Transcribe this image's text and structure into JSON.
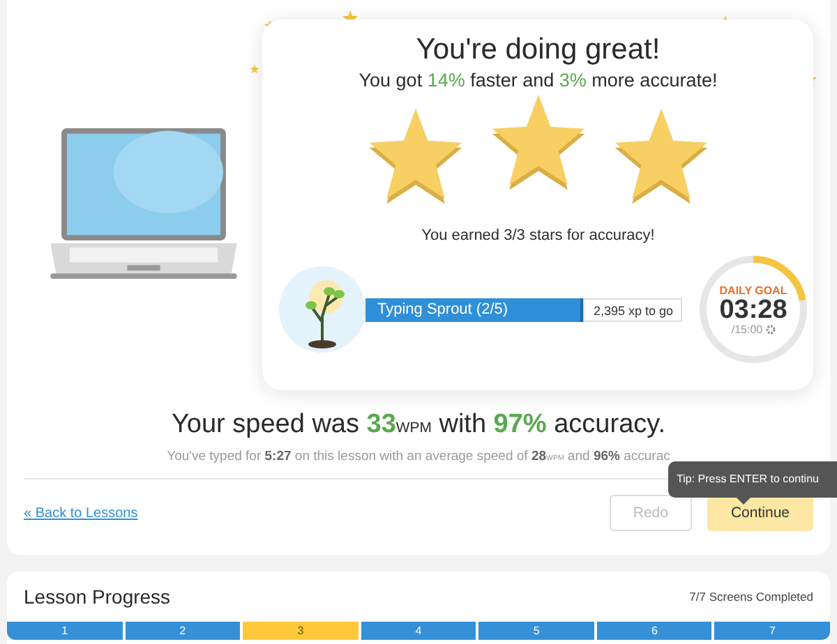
{
  "celebration": {
    "title": "You're doing great!",
    "subtitle": "You got **14%** faster and **3%** more accurate!",
    "stars": 3,
    "stars_caption": "You earned 3/3 stars for accuracy!"
  },
  "rank": {
    "name": "Typing Sprout (2/5)",
    "xp": "2,395 xp to go"
  },
  "daily_goal": {
    "label": "DAILY GOAL",
    "time": "03:28",
    "target": "/15:00",
    "level": 0.22
  },
  "speed": {
    "headline": "Your speed was **33**$_{WPM}$ with **97%** accuracy.",
    "detail": "You've typed for **5:27** on this lesson with an average speed of **28**$_{WPM}$ and **96%** accurac"
  },
  "back_link": "« Back to Lessons",
  "buttons": [
    {
      "label": "Redo",
      "disabled": true
    },
    {
      "label": "Continue",
      "disabled": false
    }
  ],
  "tooltip": "Tip: Press ENTER to continu",
  "lesson_progress": {
    "title": "Lesson Progress",
    "summary": "7/7 Screens Completed",
    "segments": [
      {
        "label": "1",
        "selected": false
      },
      {
        "label": "2",
        "selected": false
      },
      {
        "label": "3",
        "selected": true
      },
      {
        "label": "4",
        "selected": false
      },
      {
        "label": "5",
        "selected": false
      },
      {
        "label": "6",
        "selected": false
      },
      {
        "label": "7",
        "selected": false
      }
    ]
  }
}
